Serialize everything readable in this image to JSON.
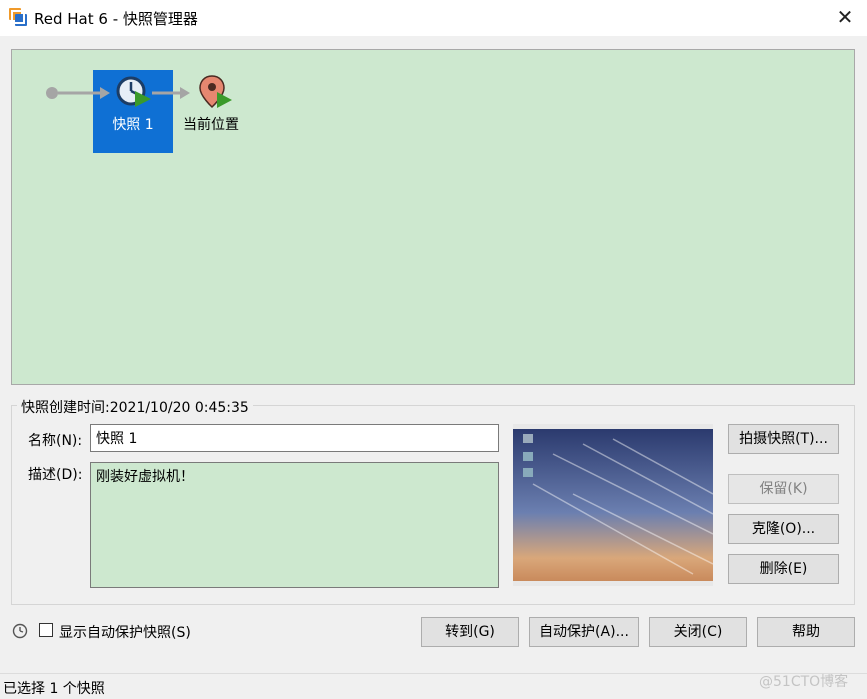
{
  "window": {
    "title": "Red Hat 6 - 快照管理器",
    "close_glyph": "✕"
  },
  "tree": {
    "snapshot_node_label": "快照 1",
    "current_node_label": "当前位置",
    "background_color": "#cde8cf",
    "selection_color": "#0f70d4"
  },
  "details": {
    "created_label": "快照创建时间:2021/10/20 0:45:35",
    "name_label": "名称(N):",
    "name_value": "快照 1",
    "desc_label": "描述(D):",
    "desc_value": "刚装好虚拟机！"
  },
  "side_buttons": {
    "take": "拍摄快照(T)...",
    "keep": "保留(K)",
    "clone": "克隆(O)...",
    "delete": "删除(E)"
  },
  "bottom": {
    "show_autoprotect_label": "显示自动保护快照(S)",
    "show_autoprotect_checked": false,
    "goto": "转到(G)",
    "autoprotect": "自动保护(A)...",
    "close": "关闭(C)",
    "help": "帮助"
  },
  "status": {
    "text": "已选择 1 个快照",
    "watermark": "@51CTO博客"
  }
}
